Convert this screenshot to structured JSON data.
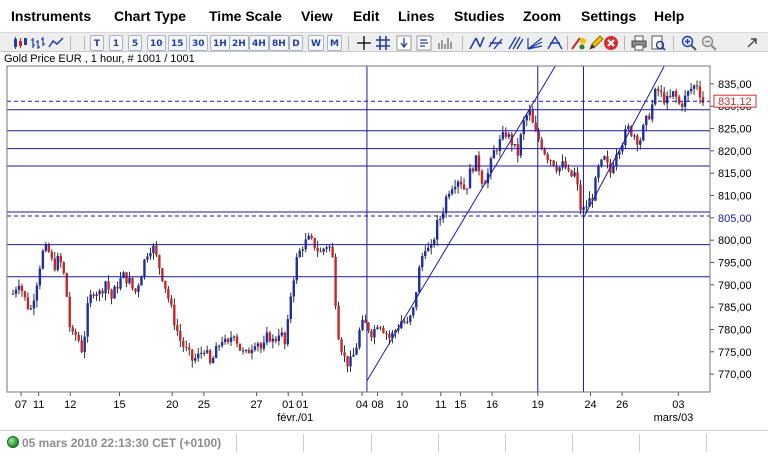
{
  "menu": {
    "items": [
      "Instruments",
      "Chart Type",
      "Time Scale",
      "View",
      "Edit",
      "Lines",
      "Studies",
      "Zoom",
      "Settings",
      "Help"
    ]
  },
  "toolbar": {
    "timescale_buttons": [
      "T",
      "1",
      "5",
      "10",
      "15",
      "30",
      "1H",
      "2H",
      "4H",
      "8H",
      "D",
      "W",
      "M"
    ]
  },
  "chart": {
    "title": "Gold Price EUR , 1 hour, # 1001 / 1001",
    "last_price_label": "831,12",
    "marked_price_label": "805,00"
  },
  "chart_data": {
    "type": "candlestick",
    "title": "Gold Price EUR , 1 hour, # 1001 / 1001",
    "ylim": [
      766,
      839
    ],
    "y_ticks": [
      "835,00",
      "830,00",
      "825,00",
      "820,00",
      "815,00",
      "810,00",
      "805,00",
      "800,00",
      "795,00",
      "790,00",
      "785,00",
      "780,00",
      "775,00",
      "770,00"
    ],
    "y_tick_values": [
      835,
      830,
      825,
      820,
      815,
      810,
      805,
      800,
      795,
      790,
      785,
      780,
      775,
      770
    ],
    "x_tick_labels": [
      "07",
      "11",
      "12",
      "15",
      "20",
      "25",
      "27",
      "01",
      "01",
      "04",
      "08",
      "10",
      "11",
      "15",
      "16",
      "19",
      "24",
      "26",
      "03"
    ],
    "x_month_labels": [
      "févr./01",
      "mars/03"
    ],
    "horizontal_lines": [
      829.2,
      824.5,
      820.5,
      816.6,
      806.3,
      799.0,
      791.8
    ],
    "dashed_lines": [
      831.12,
      805.4
    ],
    "last_price": 831.12,
    "marked_price": 805.0,
    "price_path": [
      788,
      791,
      787,
      784,
      790,
      797,
      798,
      794,
      796,
      791,
      778,
      779,
      775,
      786,
      789,
      788,
      791,
      787,
      790,
      792,
      791,
      788,
      792,
      797,
      799,
      795,
      791,
      786,
      781,
      777,
      775,
      773,
      774,
      776,
      772,
      775,
      778,
      776,
      780,
      776,
      774,
      776,
      778,
      775,
      779,
      777,
      780,
      776,
      789,
      796,
      799,
      800,
      799,
      797,
      799,
      798,
      780,
      774,
      772,
      775,
      781,
      781,
      779,
      782,
      780,
      778,
      780,
      782,
      781,
      784,
      793,
      799,
      797,
      803,
      806,
      811,
      813,
      814,
      811,
      816,
      818,
      813,
      815,
      820,
      822,
      824,
      822,
      819,
      826,
      829,
      824,
      822,
      819,
      818,
      816,
      817,
      814,
      815,
      806,
      808,
      810,
      816,
      818,
      815,
      820,
      822,
      825,
      824,
      822,
      826,
      829,
      834,
      832,
      831,
      833,
      830,
      832,
      834,
      835,
      831
    ]
  }
}
